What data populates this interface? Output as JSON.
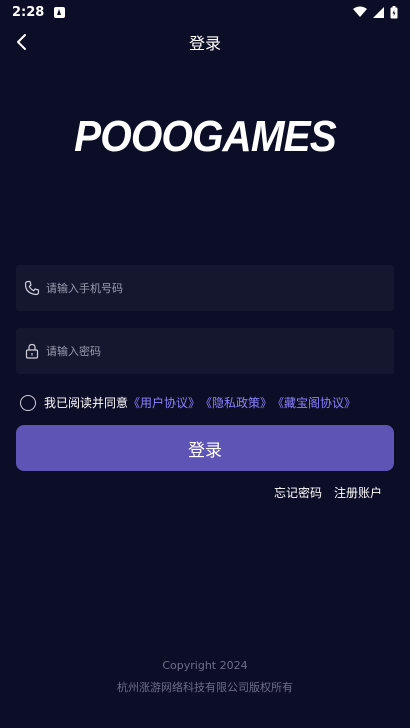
{
  "status": {
    "time": "2:28"
  },
  "header": {
    "title": "登录"
  },
  "logo": {
    "text": "POOOGAMES"
  },
  "form": {
    "phone_placeholder": "请输入手机号码",
    "password_placeholder": "请输入密码"
  },
  "agreement": {
    "prefix": "我已阅读并同意",
    "links": [
      "《用户协议》",
      "《隐私政策》",
      "《藏宝阁协议》"
    ]
  },
  "login_button": "登录",
  "links": {
    "forgot": "忘记密码",
    "register": "注册账户"
  },
  "footer": {
    "copyright": "Copyright 2024",
    "company": "杭州涨游网络科技有限公司版权所有"
  },
  "colors": {
    "background": "#0c0d26",
    "button": "#5e54b5",
    "link": "#8b82ff"
  }
}
